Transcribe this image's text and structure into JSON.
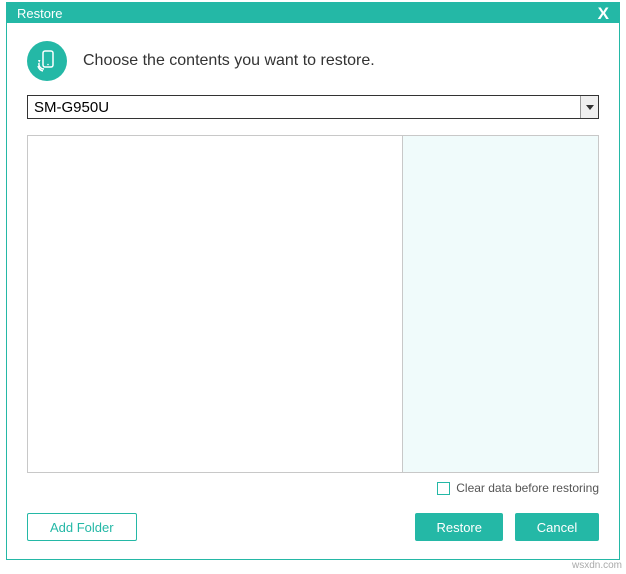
{
  "titlebar": {
    "title": "Restore"
  },
  "header": {
    "message": "Choose the contents you want to restore."
  },
  "device_select": {
    "selected": "SM-G950U"
  },
  "options": {
    "clear_data_label": "Clear data before restoring"
  },
  "buttons": {
    "add_folder": "Add Folder",
    "restore": "Restore",
    "cancel": "Cancel"
  },
  "watermark": "wsxdn.com"
}
